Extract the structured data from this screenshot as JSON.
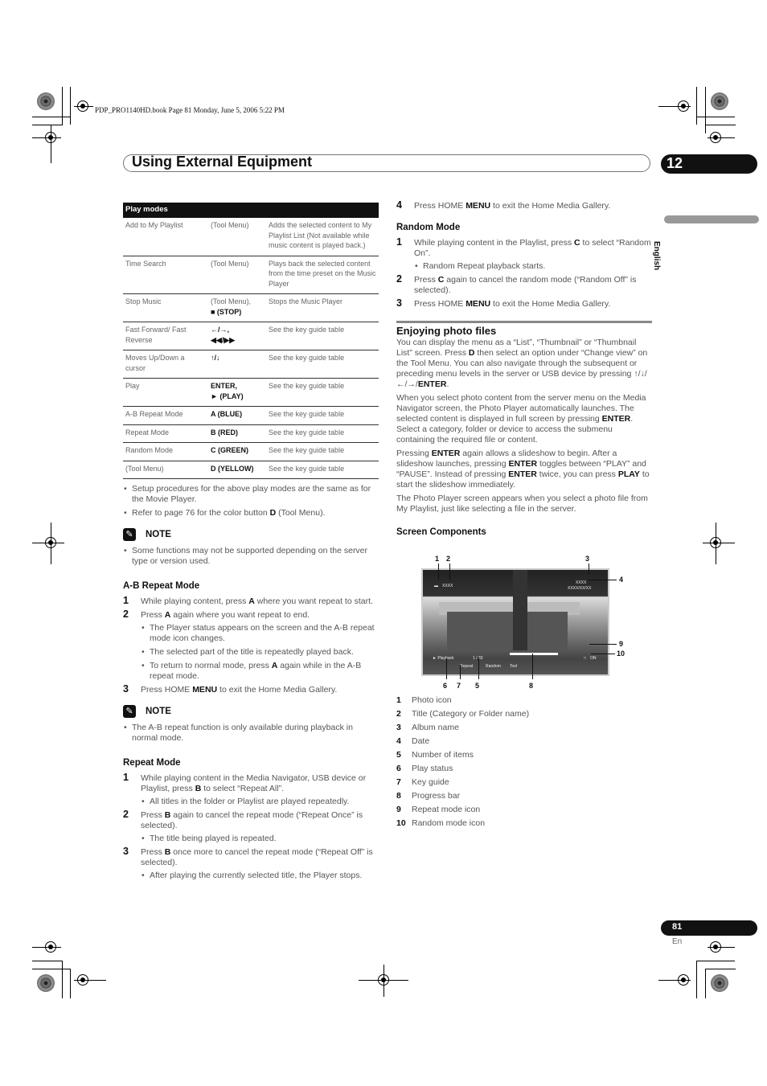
{
  "print_header": "PDP_PRO1140HD.book  Page 81  Monday, June 5, 2006  5:22 PM",
  "header": {
    "title": "Using External Equipment",
    "chapter_number": "12",
    "language_tab": "English"
  },
  "play_modes_table": {
    "heading": "Play modes",
    "rows": [
      {
        "function": "Add to My Playlist",
        "key": "(Tool Menu)",
        "key_bold": false,
        "description": "Adds the selected content to My Playlist List (Not available while music content is played back.)"
      },
      {
        "function": "Time Search",
        "key": "(Tool Menu)",
        "key_bold": false,
        "description": "Plays back the selected content from the time preset on the Music Player"
      },
      {
        "function": "Stop Music",
        "key": "(Tool Menu),",
        "key_line2": "■ (STOP)",
        "key_bold": false,
        "description": "Stops the Music Player"
      },
      {
        "function": "Fast Forward/ Fast Reverse",
        "key": "←/→,",
        "key_line2": "◀◀/▶▶",
        "key_bold": true,
        "description": "See the key guide table"
      },
      {
        "function": "Moves Up/Down a cursor",
        "key": "↑/↓",
        "key_bold": true,
        "description": "See the key guide table"
      },
      {
        "function": "Play",
        "key": "ENTER,",
        "key_line2": "► (PLAY)",
        "key_bold": true,
        "description": "See the key guide table"
      },
      {
        "function": "A-B Repeat Mode",
        "key": "A (BLUE)",
        "key_bold": true,
        "description": "See the key guide table"
      },
      {
        "function": "Repeat Mode",
        "key": "B (RED)",
        "key_bold": true,
        "description": "See the key guide table"
      },
      {
        "function": "Random Mode",
        "key": "C (GREEN)",
        "key_bold": true,
        "description": "See the key guide table"
      },
      {
        "function": "(Tool Menu)",
        "key": "D (YELLOW)",
        "key_bold": true,
        "description": "See the key guide table"
      }
    ]
  },
  "table_notes": [
    "Setup procedures for the above play modes are the same as for the Movie Player.",
    "Refer to page 76 for the color button D (Tool Menu)."
  ],
  "note1": {
    "title": "NOTE",
    "items": [
      "Some functions may not be supported depending on the server type or version used."
    ]
  },
  "ab_repeat": {
    "heading": "A-B Repeat Mode",
    "steps": [
      {
        "num": "1",
        "text": "While playing content, press A where you want repeat to start.",
        "bullets": []
      },
      {
        "num": "2",
        "text": "Press A again where you want repeat to end.",
        "bullets": [
          "The Player status appears on the screen and the A-B repeat mode icon changes.",
          "The selected part of the title is repeatedly played back.",
          "To return to normal mode, press A again while in the A-B repeat mode."
        ]
      },
      {
        "num": "3",
        "text": "Press HOME MENU to exit the Home Media Gallery.",
        "bullets": []
      }
    ]
  },
  "note2": {
    "title": "NOTE",
    "items": [
      "The A-B repeat function is only available during playback in normal mode."
    ]
  },
  "repeat_mode": {
    "heading": "Repeat Mode",
    "steps": [
      {
        "num": "1",
        "text": "While playing content in the Media Navigator, USB device or Playlist, press B to select “Repeat All”.",
        "bullets": [
          "All titles in the folder or Playlist are played repeatedly."
        ]
      },
      {
        "num": "2",
        "text": "Press B again to cancel the repeat mode (“Repeat Once” is selected).",
        "bullets": [
          "The title being played is repeated."
        ]
      },
      {
        "num": "3",
        "text": "Press B once more to cancel the repeat mode (“Repeat Off” is selected).",
        "bullets": [
          "After playing the currently selected title, the Player stops."
        ]
      },
      {
        "num": "4",
        "text": "Press HOME MENU to exit the Home Media Gallery.",
        "bullets": []
      }
    ]
  },
  "random_mode": {
    "heading": "Random Mode",
    "steps": [
      {
        "num": "1",
        "text": "While playing content in the Playlist, press C to select “Random On”.",
        "bullets": [
          "Random Repeat playback starts."
        ]
      },
      {
        "num": "2",
        "text": "Press C again to cancel the random mode (“Random Off” is selected).",
        "bullets": []
      },
      {
        "num": "3",
        "text": "Press HOME MENU to exit the Home Media Gallery.",
        "bullets": []
      }
    ]
  },
  "photo_section": {
    "heading": "Enjoying photo files",
    "paragraphs": [
      "You can display the menu as a “List”, “Thumbnail” or “Thumbnail List” screen. Press D then select an option under “Change view” on the Tool Menu. You can also navigate through the subsequent or preceding menu levels in the server or USB device by pressing ↑/↓/←/→/ENTER.",
      "When you select photo content from the server menu on the Media Navigator screen, the Photo Player automatically launches. The selected content is displayed in full screen by pressing ENTER. Select a category, folder or device to access the submenu containing the required file or content.",
      "Pressing ENTER again allows a slideshow to begin. After a slideshow launches, pressing ENTER toggles between “PLAY” and “PAUSE”. Instead of pressing ENTER twice, you can press PLAY to start the slideshow immediately.",
      "The Photo Player screen appears when you select a photo file from My Playlist, just like selecting a file in the server."
    ]
  },
  "screen_components": {
    "heading": "Screen Components",
    "screen_labels": {
      "title": "XXXX",
      "album": "XXXX",
      "date": "XXXX/XX/XX",
      "status": "► Playback",
      "count": "1 / 33",
      "key_repeat": "Repeat",
      "key_random": "Random",
      "key_tool": "Tool",
      "random_icon_label": "ON"
    },
    "callouts": [
      "1",
      "2",
      "3",
      "4",
      "5",
      "6",
      "7",
      "8",
      "9",
      "10"
    ],
    "legend": [
      {
        "num": "1",
        "label": "Photo icon"
      },
      {
        "num": "2",
        "label": "Title (Category or Folder name)"
      },
      {
        "num": "3",
        "label": "Album name"
      },
      {
        "num": "4",
        "label": "Date"
      },
      {
        "num": "5",
        "label": "Number of items"
      },
      {
        "num": "6",
        "label": "Play status"
      },
      {
        "num": "7",
        "label": "Key guide"
      },
      {
        "num": "8",
        "label": "Progress bar"
      },
      {
        "num": "9",
        "label": "Repeat mode icon"
      },
      {
        "num": "10",
        "label": "Random mode icon"
      }
    ]
  },
  "footer": {
    "page_number": "81",
    "language": "En"
  }
}
